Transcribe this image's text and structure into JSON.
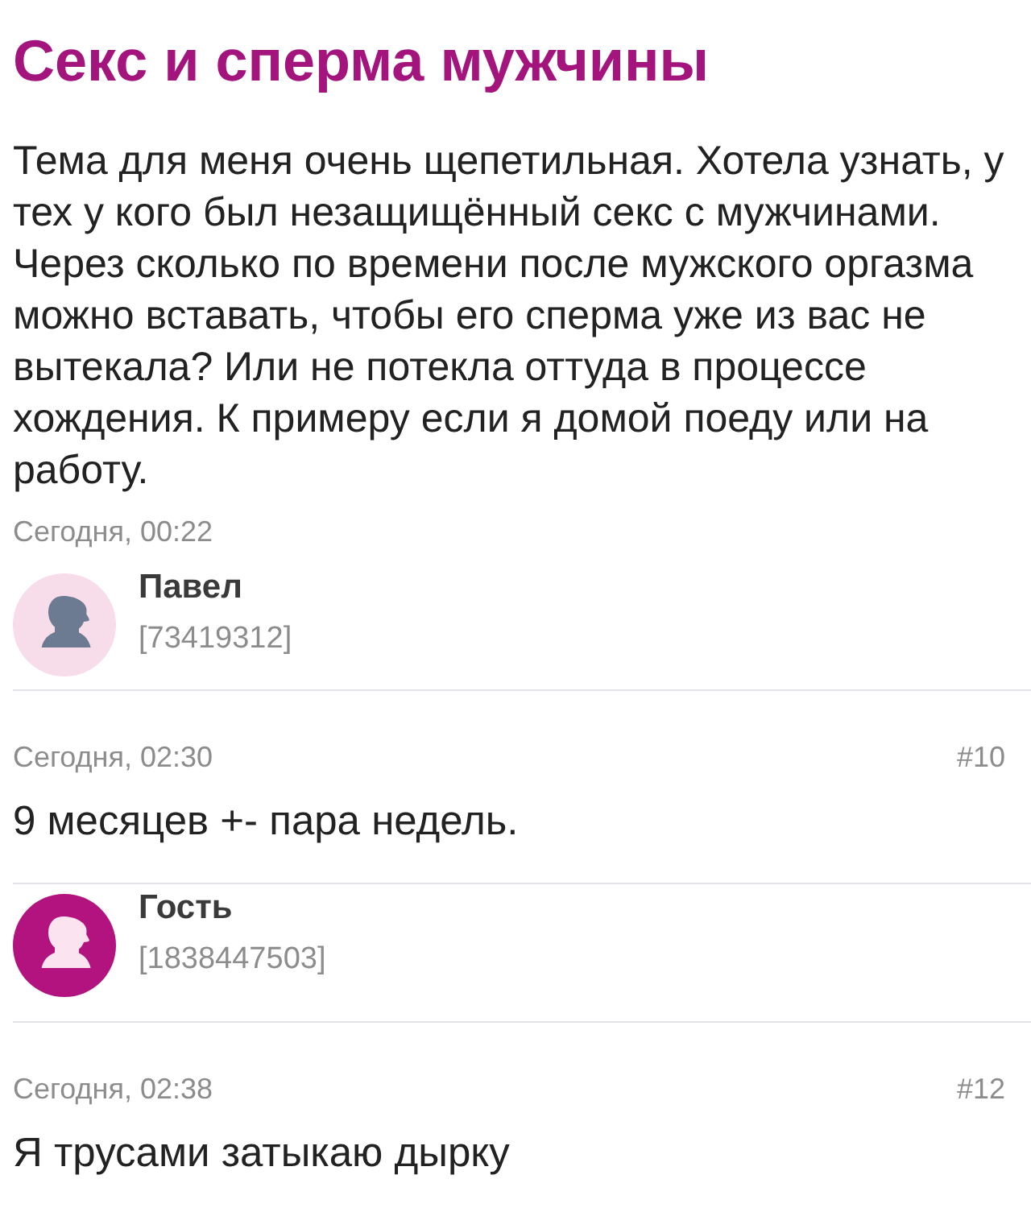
{
  "question": {
    "title": "Секс и сперма мужчины",
    "body": "Тема для меня очень щепетильная. Хотела узнать, у тех у кого был незащищённый секс с мужчинами. Через сколько по времени после мужского оргазма можно вставать, чтобы его сперма уже из вас не вытекала? Или не потекла оттуда в процессе хождения. К примеру если я домой поеду или на работу.",
    "date": "Сегодня, 00:22",
    "author": {
      "kind": "member",
      "name": "Павел",
      "id": "[73419312]"
    }
  },
  "replies": [
    {
      "date": "Сегодня, 02:30",
      "number": "#10",
      "text": "9 месяцев +- пара недель.",
      "author": {
        "kind": "guest",
        "name": "Гость",
        "id": "[1838447503]"
      }
    },
    {
      "date": "Сегодня, 02:38",
      "number": "#12",
      "text": "Я трусами затыкаю дырку"
    }
  ]
}
